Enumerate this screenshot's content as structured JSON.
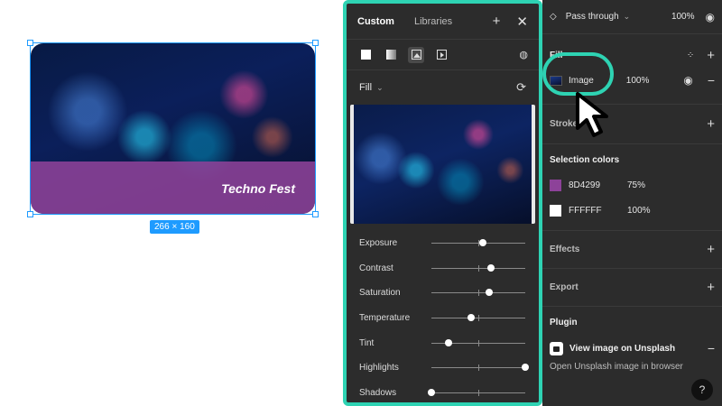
{
  "canvas": {
    "frame_title": "Techno Fest",
    "size_badge": "266 × 160"
  },
  "picker": {
    "tabs": [
      {
        "label": "Custom",
        "active": true
      },
      {
        "label": "Libraries",
        "active": false
      }
    ],
    "fill_mode": "Fill",
    "adjustments": [
      {
        "label": "Exposure",
        "value": 0.55
      },
      {
        "label": "Contrast",
        "value": 0.63
      },
      {
        "label": "Saturation",
        "value": 0.62
      },
      {
        "label": "Temperature",
        "value": 0.42
      },
      {
        "label": "Tint",
        "value": 0.18
      },
      {
        "label": "Highlights",
        "value": 1.0
      },
      {
        "label": "Shadows",
        "value": 0.0
      }
    ]
  },
  "props": {
    "blend_mode": "Pass through",
    "opacity": "100%",
    "fill": {
      "title": "Fill",
      "type": "Image",
      "opacity": "100%"
    },
    "stroke": {
      "title": "Stroke"
    },
    "selection_colors": {
      "title": "Selection colors",
      "items": [
        {
          "hex": "8D4299",
          "opacity": "75%",
          "color": "#8D4299"
        },
        {
          "hex": "FFFFFF",
          "opacity": "100%",
          "color": "#FFFFFF"
        }
      ]
    },
    "effects": {
      "title": "Effects"
    },
    "export": {
      "title": "Export"
    },
    "plugin": {
      "title": "Plugin",
      "name": "View image on Unsplash",
      "description": "Open Unsplash image in browser"
    },
    "help": "?"
  },
  "colors": {
    "highlight": "#2ed3b3",
    "selection": "#1e9bff",
    "panel": "#2c2c2c"
  }
}
